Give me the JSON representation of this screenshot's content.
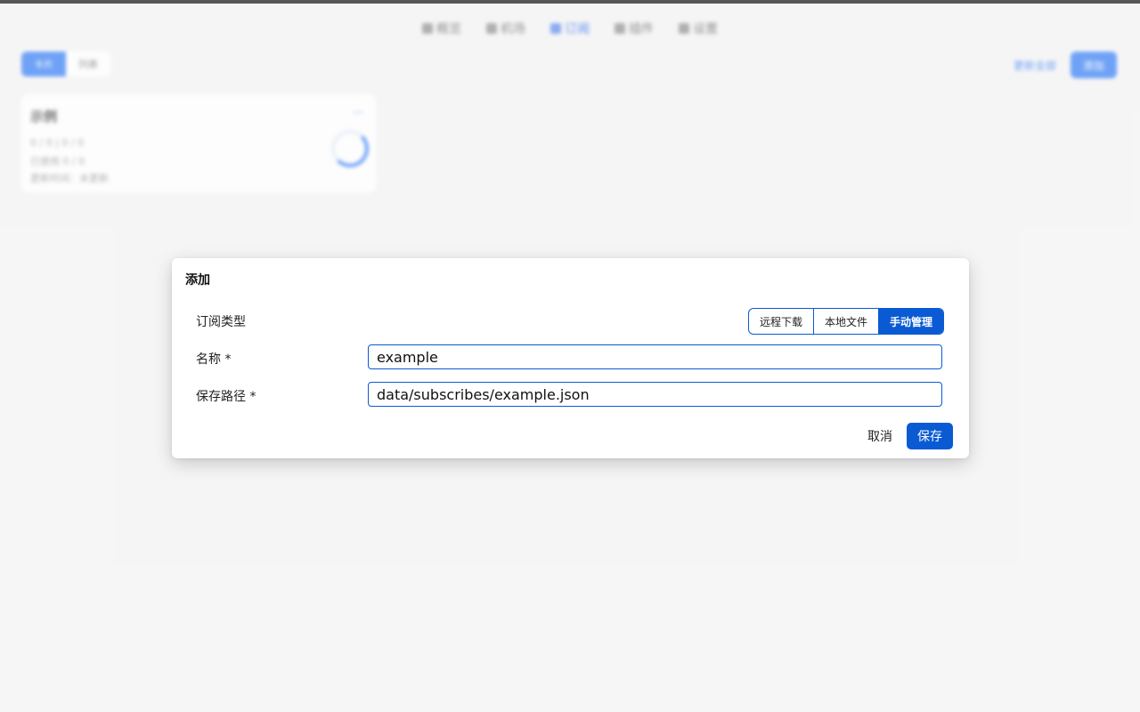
{
  "background": {
    "nav": [
      {
        "label": "概览"
      },
      {
        "label": "机场"
      },
      {
        "label": "订阅"
      },
      {
        "label": "插件"
      },
      {
        "label": "设置"
      }
    ],
    "view_toggle": [
      "卡片",
      "列表"
    ],
    "actions": {
      "link": "更新全部",
      "button": "添加"
    },
    "card": {
      "title": "示例",
      "menu": "···",
      "lines": [
        "0 / 0 | 0 / 0",
        "已使用 0 / 0",
        "更新时间：未更新"
      ]
    }
  },
  "modal": {
    "title": "添加",
    "type_label": "订阅类型",
    "type_options": [
      "远程下载",
      "本地文件",
      "手动管理"
    ],
    "type_selected": "手动管理",
    "name_label": "名称 *",
    "name_value": "example",
    "path_label": "保存路径 *",
    "path_value": "data/subscribes/example.json",
    "cancel_label": "取消",
    "save_label": "保存"
  },
  "colors": {
    "accent": "#0a5bd3",
    "bg_accent": "#3b82f6"
  }
}
